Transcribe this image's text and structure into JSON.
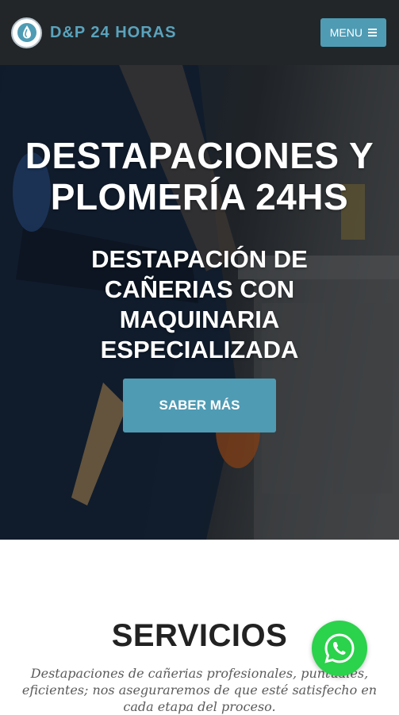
{
  "header": {
    "brand": "D&P 24 HORAS",
    "menu_label": "MENU",
    "logo_icon": "water-drop-icon",
    "menu_icon": "hamburger-icon"
  },
  "hero": {
    "title": "DESTAPACIONES Y PLOMERÍA 24HS",
    "subtitle": "DESTAPACIÓN DE CAÑERIAS CON MAQUINARIA ESPECIALIZADA",
    "cta_label": "SABER MÁS"
  },
  "services": {
    "title": "SERVICIOS",
    "description": "Destapaciones de cañerias profesionales, puntuales, eficientes; nos aseguraremos de que esté satisfecho en cada etapa del proceso."
  },
  "floating": {
    "whatsapp_icon": "whatsapp-icon"
  },
  "colors": {
    "header_bg": "#222629",
    "accent": "#4f9bb4",
    "brand_text": "#5aa3bd",
    "whatsapp": "#2bd24b"
  }
}
